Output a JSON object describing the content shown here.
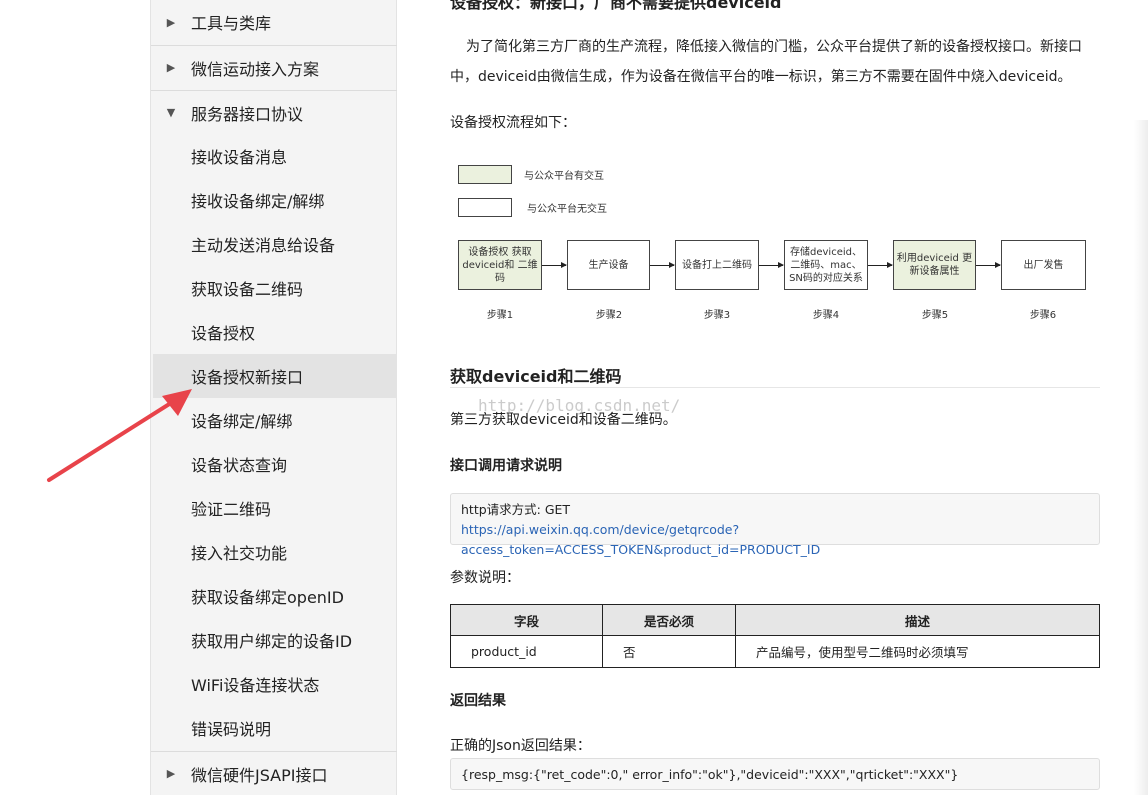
{
  "sidebar": {
    "groups_top": [
      {
        "label": "工具与类库",
        "expanded": false
      },
      {
        "label": "微信运动接入方案",
        "expanded": false
      },
      {
        "label": "服务器接口协议",
        "expanded": true
      }
    ],
    "items": [
      {
        "label": "接收设备消息"
      },
      {
        "label": "接收设备绑定/解绑"
      },
      {
        "label": "主动发送消息给设备"
      },
      {
        "label": "获取设备二维码"
      },
      {
        "label": "设备授权"
      },
      {
        "label": "设备授权新接口",
        "active": true
      },
      {
        "label": "设备绑定/解绑"
      },
      {
        "label": "设备状态查询"
      },
      {
        "label": "验证二维码"
      },
      {
        "label": "接入社交功能"
      },
      {
        "label": "获取设备绑定openID"
      },
      {
        "label": "获取用户绑定的设备ID"
      },
      {
        "label": "WiFi设备连接状态"
      },
      {
        "label": "错误码说明"
      }
    ],
    "groups_bottom": [
      {
        "label": "微信硬件JSAPI接口",
        "expanded": false
      }
    ]
  },
  "main": {
    "section_title": "设备授权：新接口，厂商不需要提供deviceid",
    "intro_line1": "为了简化第三方厂商的生产流程，降低接入微信的门槛，公众平台提供了新的设备授权接口。新接口",
    "intro_line2": "中，deviceid由微信生成，作为设备在微信平台的唯一标识，第三方不需要在固件中烧入deviceid。",
    "flow_intro": "设备授权流程如下：",
    "diagram": {
      "legend_green": "与公众平台有交互",
      "legend_white": "与公众平台无交互",
      "steps": [
        {
          "text": "设备授权 获取deviceid和 二维码",
          "label": "步骤1",
          "interactive": true
        },
        {
          "text": "生产设备",
          "label": "步骤2",
          "interactive": false
        },
        {
          "text": "设备打上二维码",
          "label": "步骤3",
          "interactive": false
        },
        {
          "text": "存储deviceid、 二维码、mac、 SN码的对应关系",
          "label": "步骤4",
          "interactive": false
        },
        {
          "text": "利用deviceid 更新设备属性",
          "label": "步骤5",
          "interactive": true
        },
        {
          "text": "出厂发售",
          "label": "步骤6",
          "interactive": false
        }
      ]
    },
    "heading_get": "获取deviceid和二维码",
    "watermark": "http://blog.csdn.net/",
    "get_desc": "第三方获取deviceid和设备二维码。",
    "req_heading": "接口调用请求说明",
    "req_method": "http请求方式: GET",
    "req_url": "https://api.weixin.qq.com/device/getqrcode?access_token=ACCESS_TOKEN&product_id=PRODUCT_ID",
    "params_heading": "参数说明：",
    "params_table": {
      "headers": [
        "字段",
        "是否必须",
        "描述"
      ],
      "rows": [
        {
          "field": "product_id",
          "required": "否",
          "desc": "产品编号，使用型号二维码时必须填写"
        }
      ]
    },
    "result_heading": "返回结果",
    "result_intro": "正确的Json返回结果：",
    "result_json": "{resp_msg:{\"ret_code\":0,\" error_info\":\"ok\"},\"deviceid\":\"XXX\",\"qrticket\":\"XXX\"}"
  },
  "annotation": {
    "arrow_color": "#e8434a"
  },
  "colors": {
    "interactive_box": "#ebf1de",
    "link": "#2a64b5",
    "active_item_bg": "#e3e3e3"
  }
}
